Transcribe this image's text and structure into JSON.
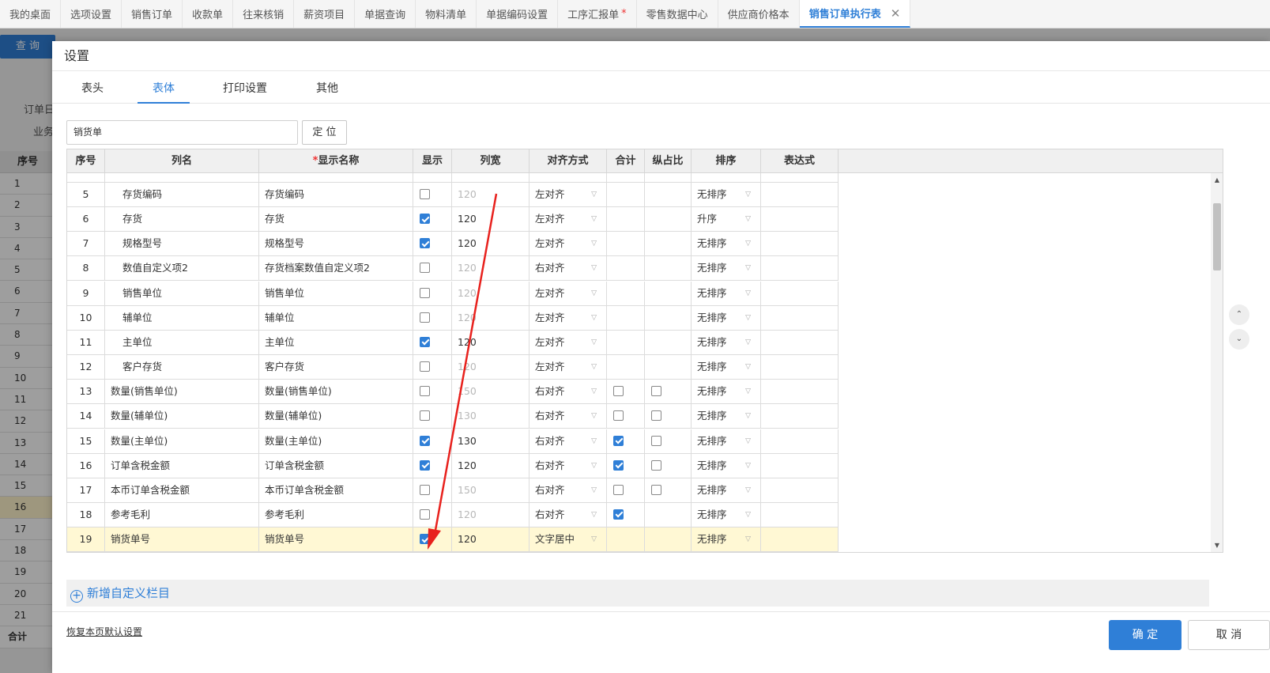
{
  "top_tabs": [
    {
      "label": "我的桌面"
    },
    {
      "label": "选项设置"
    },
    {
      "label": "销售订单"
    },
    {
      "label": "收款单"
    },
    {
      "label": "往来核销"
    },
    {
      "label": "薪资项目"
    },
    {
      "label": "单据查询"
    },
    {
      "label": "物料清单"
    },
    {
      "label": "单据编码设置"
    },
    {
      "label": "工序汇报单",
      "modified": "*"
    },
    {
      "label": "零售数据中心"
    },
    {
      "label": "供应商价格本"
    },
    {
      "label": "销售订单执行表",
      "close": "✕"
    }
  ],
  "background": {
    "query_button": "查 询",
    "label_order_date": "订单日",
    "label_business": "业务",
    "seq_header": "序号",
    "rows": [
      "1",
      "2",
      "3",
      "4",
      "5",
      "6",
      "7",
      "8",
      "9",
      "10",
      "11",
      "12",
      "13",
      "14",
      "15",
      "16",
      "17",
      "18",
      "19",
      "20",
      "21"
    ],
    "total_label": "合计"
  },
  "dialog": {
    "title": "设置",
    "tabs": [
      {
        "label": "表头"
      },
      {
        "label": "表体"
      },
      {
        "label": "打印设置"
      },
      {
        "label": "其他"
      }
    ],
    "bill_select_value": "销货单",
    "locate_button": "定 位",
    "columns": {
      "seq": "序号",
      "col_name": "列名",
      "display_name_required": "*",
      "display_name": "显示名称",
      "show": "显示",
      "width": "列宽",
      "align": "对齐方式",
      "sum": "合计",
      "ratio": "纵占比",
      "sort": "排序",
      "expr": "表达式"
    },
    "rows": [
      {
        "seq": "5",
        "name": "存货编码",
        "display": "存货编码",
        "show": false,
        "width": "120",
        "align": "左对齐",
        "sort": "无排序",
        "indent": true
      },
      {
        "seq": "6",
        "name": "存货",
        "display": "存货",
        "show": true,
        "width": "120",
        "align": "左对齐",
        "sort": "升序",
        "indent": true
      },
      {
        "seq": "7",
        "name": "规格型号",
        "display": "规格型号",
        "show": true,
        "width": "120",
        "align": "左对齐",
        "sort": "无排序",
        "indent": true
      },
      {
        "seq": "8",
        "name": "数值自定义项2",
        "display": "存货档案数值自定义项2",
        "show": false,
        "width": "120",
        "align": "右对齐",
        "sort": "无排序",
        "indent": true
      },
      {
        "seq": "9",
        "name": "销售单位",
        "display": "销售单位",
        "show": false,
        "width": "120",
        "align": "左对齐",
        "sort": "无排序",
        "indent": true
      },
      {
        "seq": "10",
        "name": "辅单位",
        "display": "辅单位",
        "show": false,
        "width": "120",
        "align": "左对齐",
        "sort": "无排序",
        "indent": true
      },
      {
        "seq": "11",
        "name": "主单位",
        "display": "主单位",
        "show": true,
        "width": "120",
        "align": "左对齐",
        "sort": "无排序",
        "indent": true
      },
      {
        "seq": "12",
        "name": "客户存货",
        "display": "客户存货",
        "show": false,
        "width": "120",
        "align": "左对齐",
        "sort": "无排序",
        "indent": true
      },
      {
        "seq": "13",
        "name": "数量(销售单位)",
        "display": "数量(销售单位)",
        "show": false,
        "width": "150",
        "align": "右对齐",
        "sum": false,
        "ratio": false,
        "sort": "无排序"
      },
      {
        "seq": "14",
        "name": "数量(辅单位)",
        "display": "数量(辅单位)",
        "show": false,
        "width": "130",
        "align": "右对齐",
        "sum": false,
        "ratio": false,
        "sort": "无排序"
      },
      {
        "seq": "15",
        "name": "数量(主单位)",
        "display": "数量(主单位)",
        "show": true,
        "width": "130",
        "align": "右对齐",
        "sum": true,
        "ratio": false,
        "sort": "无排序"
      },
      {
        "seq": "16",
        "name": "订单含税金额",
        "display": "订单含税金额",
        "show": true,
        "width": "120",
        "align": "右对齐",
        "sum": true,
        "ratio": false,
        "sort": "无排序"
      },
      {
        "seq": "17",
        "name": "本币订单含税金额",
        "display": "本币订单含税金额",
        "show": false,
        "width": "150",
        "align": "右对齐",
        "sum": false,
        "ratio": false,
        "sort": "无排序"
      },
      {
        "seq": "18",
        "name": "参考毛利",
        "display": "参考毛利",
        "show": false,
        "width": "120",
        "align": "右对齐",
        "sum": true,
        "sort": "无排序"
      },
      {
        "seq": "19",
        "name": "销货单号",
        "display": "销货单号",
        "show": true,
        "width": "120",
        "align": "文字居中",
        "sort": "无排序",
        "selected": true
      }
    ],
    "add_custom": "新增自定义栏目",
    "restore_defaults": "恢复本页默认设置",
    "ok_button": "确 定",
    "cancel_button": "取 消"
  },
  "colors": {
    "accent": "#2f7fd7",
    "annotation_arrow": "#e8211d",
    "selected_row": "#fff8d4"
  }
}
